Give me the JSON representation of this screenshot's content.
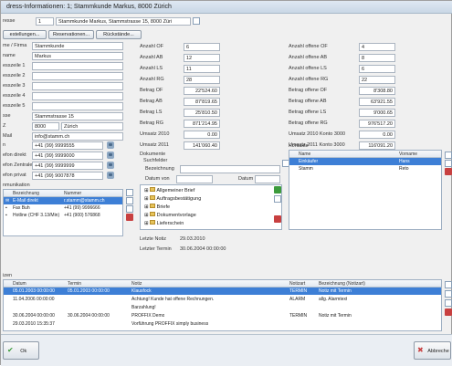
{
  "window": {
    "title": "dress-Informationen: 1; Stammkunde Markus, 8000 Zürich"
  },
  "header": {
    "label": "resse",
    "id_value": "1",
    "address_value": "Stammkunde Markus, Stammstrasse 15, 8000 Züri"
  },
  "tabs": [
    "estellungen...",
    "Reservationen...",
    "Rückstände..."
  ],
  "address": {
    "fields": [
      {
        "label": "me / Firma",
        "value": "Stammkunde"
      },
      {
        "label": "name",
        "value": "Markus"
      },
      {
        "label": "esszeile 1",
        "value": ""
      },
      {
        "label": "esszeile 2",
        "value": ""
      },
      {
        "label": "esszeile 3",
        "value": ""
      },
      {
        "label": "esszeile 4",
        "value": ""
      },
      {
        "label": "esszeile 5",
        "value": ""
      },
      {
        "label": "sse",
        "value": "Stammstrasse 15"
      }
    ],
    "zip_label": "Z",
    "zip": "8000",
    "city": "Zürich",
    "mail_label": "Mail",
    "mail": "info@stamm.ch",
    "phones": [
      {
        "label": "n",
        "value": "+41 (99) 9999555"
      },
      {
        "label": "efon direkt",
        "value": "+41 (99) 9999000"
      },
      {
        "label": "efon Zentrale",
        "value": "+41 (99) 9999999"
      },
      {
        "label": "efon privat",
        "value": "+41 (99) 9007878"
      }
    ]
  },
  "stats_left": [
    {
      "label": "Anzahl OF",
      "value": "6"
    },
    {
      "label": "Anzahl AB",
      "value": "12"
    },
    {
      "label": "Anzahl LS",
      "value": "11"
    },
    {
      "label": "Anzahl RG",
      "value": "28"
    },
    {
      "label": "Betrag OF",
      "value": "22'524.60"
    },
    {
      "label": "Betrag AB",
      "value": "87'819.65"
    },
    {
      "label": "Betrag LS",
      "value": "25'810.50"
    },
    {
      "label": "Betrag RG",
      "value": "871'214.95"
    },
    {
      "label": "Umsatz 2010",
      "value": "0.00"
    },
    {
      "label": "Umsatz 2011",
      "value": "141'060.40"
    }
  ],
  "stats_right": [
    {
      "label": "Anzahl offene OF",
      "value": "4"
    },
    {
      "label": "Anzahl offene AB",
      "value": "8"
    },
    {
      "label": "Anzahl offene LS",
      "value": "6"
    },
    {
      "label": "Anzahl offene RG",
      "value": "22"
    },
    {
      "label": "Betrag offene OF",
      "value": "8'308.80"
    },
    {
      "label": "Betrag offene AB",
      "value": "63'921.55"
    },
    {
      "label": "Betrag offene LS",
      "value": "9'000.65"
    },
    {
      "label": "Betrag offene RG",
      "value": "976'517.20"
    },
    {
      "label": "Umsatz 2010 Konto 3000",
      "value": "0.00"
    },
    {
      "label": "Umsatz 2011 Konto 3000",
      "value": "116'091.20"
    }
  ],
  "kommunikation": {
    "title": "nmunikation",
    "columns": [
      "Bezeichnung",
      "Nummer"
    ],
    "rows": [
      {
        "name": "E-Mail direkt",
        "number": "r.stamm@stamm.ch"
      },
      {
        "name": "Fax Buh",
        "number": "+41 (99) 9996666"
      },
      {
        "name": "Hotline (CHF 3.13/Min)",
        "number": "+41 (900) 576868"
      }
    ]
  },
  "dokumente": {
    "title": "Dokumente",
    "suchfelder": "Suchfelder",
    "bezeichnung_label": "Bezeichnung",
    "datum_von_label": "Datum von",
    "datum_bis_label": "Datum bis",
    "tree": [
      "Allgemeiner Brief",
      "Auftragsbestätigung",
      "Briefe",
      "Dokumentvorlage",
      "Lieferschein"
    ],
    "letzte_notiz_label": "Letzte Notiz",
    "letzte_notiz": "29.03.2010",
    "letzter_termin_label": "Letzter Termin",
    "letzter_termin": "30.06.2004 00:00:00"
  },
  "kontakte": {
    "title": "Kontakte",
    "columns": [
      "Name",
      "Vorname"
    ],
    "rows": [
      {
        "name": "Einkäufer",
        "vorname": "Hans"
      },
      {
        "name": "Stamm",
        "vorname": "Reto"
      }
    ]
  },
  "notizen": {
    "title": "izen",
    "columns": [
      "Datum",
      "Termin",
      "Notiz",
      "Notizart",
      "Bezeichnung (Notizart)"
    ],
    "rows": [
      {
        "datum": "05.01.2003 00:00:00",
        "termin": "05.01.2003 00:00:00",
        "notiz": "Klausfock",
        "art": "TERMIN",
        "bez": "Notiz mit Termin"
      },
      {
        "datum": "11.04.2006 00:00:00",
        "termin": "",
        "notiz": "Achtung! Kunde hat offene Rechnungen.",
        "art": "ALARM",
        "bez": "allg. Alarmtext"
      },
      {
        "datum": "",
        "termin": "",
        "notiz": "Barzahlung!",
        "art": "",
        "bez": ""
      },
      {
        "datum": "30.06.2004 00:00:00",
        "termin": "30.06.2004 00:00:00",
        "notiz": "PROFFIX Demo",
        "art": "TERMIN",
        "bez": "Notiz mit Termin"
      },
      {
        "datum": "29.03.2010 15:35:37",
        "termin": "",
        "notiz": "Vorführung PROFFIX simply business",
        "art": "",
        "bez": ""
      }
    ]
  },
  "footer": {
    "ok_label": "Ok",
    "cancel_label": "Abbreche"
  },
  "colors": {
    "selection": "#3d7fd6",
    "ok_icon": "#3c9b3c",
    "cancel_icon": "#c84040"
  }
}
